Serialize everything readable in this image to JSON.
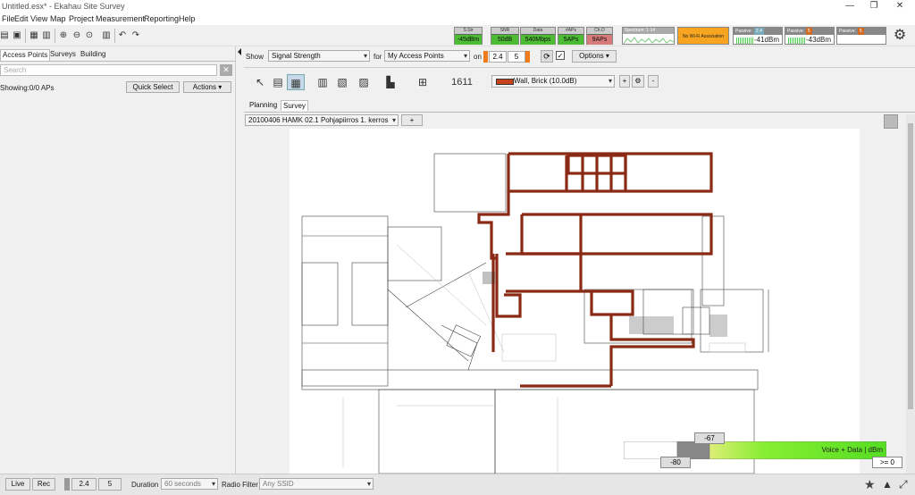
{
  "window": {
    "title": "Untitled.esx* - Ekahau Site Survey",
    "min_icon": "minimize-icon",
    "max_icon": "restore-icon",
    "close_icon": "close-icon"
  },
  "menu": [
    "File",
    "Edit",
    "View",
    "Map",
    "Project",
    "Measurement",
    "Reporting",
    "Help"
  ],
  "status_tiles": [
    {
      "label": "S.Str",
      "value": "-45dBm",
      "color": "#4dbb34"
    },
    {
      "label": "SNR",
      "value": "50dB",
      "color": "#4dbb34"
    },
    {
      "label": "Data",
      "value": "540Mbps",
      "color": "#4dbb34"
    },
    {
      "label": "#APs",
      "value": "5APs",
      "color": "#4dbb34"
    },
    {
      "label": "Ch.O",
      "value": "9APs",
      "color": "#d77a7a"
    }
  ],
  "spectrum": {
    "label": "Spectrum: 1-14"
  },
  "no_wifi": {
    "label": "No Wi-Fi Association"
  },
  "passive": [
    {
      "label": "Passive:",
      "band": "2.4",
      "value": "-41dBm"
    },
    {
      "label": "Passive:",
      "band": "5",
      "value": "-43dBm"
    },
    {
      "label": "Passive:",
      "band": "5",
      "value": ""
    }
  ],
  "left_panel": {
    "tabs": [
      "Access Points",
      "Surveys",
      "Building"
    ],
    "search_placeholder": "Search",
    "showing": "Showing:0/0 APs",
    "quick_select": "Quick Select",
    "actions": "Actions"
  },
  "main": {
    "show_label": "Show",
    "show_value": "Signal Strength",
    "for_label": "for",
    "for_value": "My Access Points",
    "on_label": "on",
    "band1": "2.4",
    "band2": "5",
    "options": "Options",
    "wall_type": "Wall, Brick (10.0dB)",
    "tool_number": "1611",
    "subtabs": [
      "Planning",
      "Survey"
    ],
    "map_name": "20100406 HAMK 02.1 Pohjapiirros 1. kerros",
    "add_map": "+",
    "zoom_plus": "+",
    "zoom_minus": "-"
  },
  "legend": {
    "top_value": "-67",
    "low_value": "-80",
    "label": "Voice + Data | dBm",
    "high_value": ">= 0"
  },
  "statusbar": {
    "live": "Live",
    "rec": "Rec",
    "band1": "2.4",
    "band2": "5",
    "duration_label": "Duration",
    "duration_value": "60 seconds",
    "radio_label": "Radio Filter",
    "radio_value": "Any SSID"
  }
}
